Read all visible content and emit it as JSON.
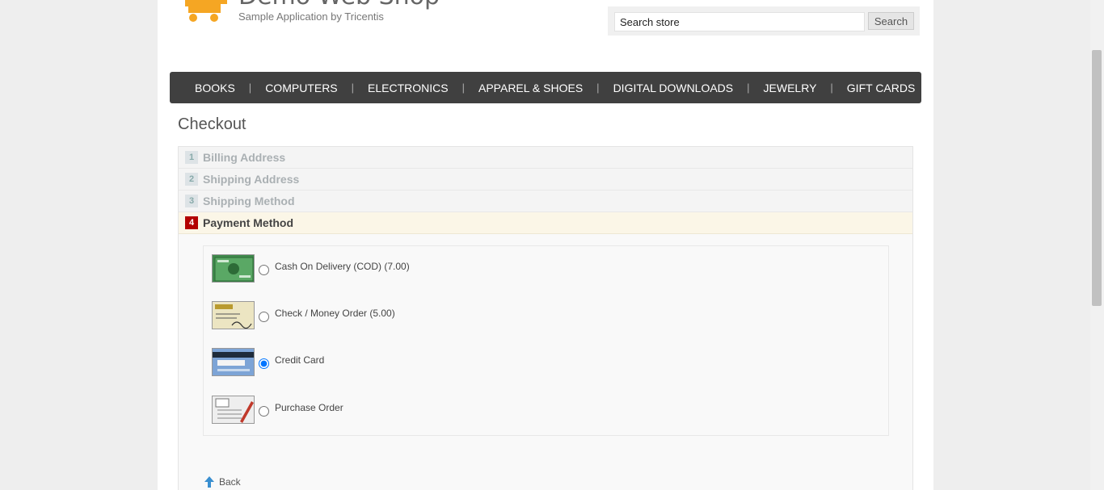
{
  "header": {
    "title": "Demo Web Shop",
    "subtitle": "Sample Application by Tricentis",
    "logo_icon": "shopping-cart-icon"
  },
  "search": {
    "value": "Search store",
    "button_label": "Search"
  },
  "nav": {
    "items": [
      {
        "label": "BOOKS"
      },
      {
        "label": "COMPUTERS"
      },
      {
        "label": "ELECTRONICS"
      },
      {
        "label": "APPAREL & SHOES"
      },
      {
        "label": "DIGITAL DOWNLOADS"
      },
      {
        "label": "JEWELRY"
      },
      {
        "label": "GIFT CARDS"
      }
    ],
    "separator": "|"
  },
  "page_title": "Checkout",
  "steps": [
    {
      "number": "1",
      "label": "Billing Address"
    },
    {
      "number": "2",
      "label": "Shipping Address"
    },
    {
      "number": "3",
      "label": "Shipping Method"
    },
    {
      "number": "4",
      "label": "Payment Method",
      "active": true
    }
  ],
  "payment_methods": [
    {
      "label": "Cash On Delivery (COD) (7.00)",
      "icon": "cash-card-icon",
      "selected": false
    },
    {
      "label": "Check / Money Order (5.00)",
      "icon": "check-icon",
      "selected": false
    },
    {
      "label": "Credit Card",
      "icon": "credit-card-icon",
      "selected": true
    },
    {
      "label": "Purchase Order",
      "icon": "purchase-order-icon",
      "selected": false
    }
  ],
  "back_label": "Back",
  "colors": {
    "nav_bg": "#404040",
    "active_step_badge": "#b30000",
    "logo_orange": "#f5a623"
  }
}
